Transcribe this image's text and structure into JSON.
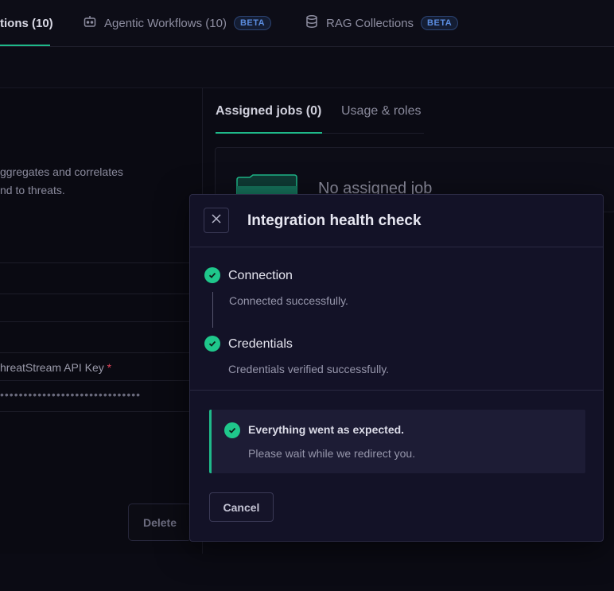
{
  "top_tabs": [
    {
      "label": "tions (10)",
      "active": true
    },
    {
      "label": "Agentic Workflows (10)",
      "badge": "BETA",
      "icon": "robot-icon"
    },
    {
      "label": "RAG Collections",
      "badge": "BETA",
      "icon": "database-icon"
    }
  ],
  "left_panel": {
    "description_line1": "ggregates and correlates",
    "description_line2": "nd to threats.",
    "api_key_label": "hreatStream API Key",
    "required_mark": "*",
    "api_key_value": "••••••••••••••••••••••••••••••",
    "delete_label": "Delete"
  },
  "right_panel": {
    "tabs": [
      {
        "label": "Assigned jobs (0)",
        "active": true
      },
      {
        "label": "Usage & roles",
        "active": false
      }
    ],
    "empty_text": "No assigned job",
    "empty_icon": "folder-icon"
  },
  "dialog": {
    "title": "Integration health check",
    "close_icon": "close-icon",
    "steps": [
      {
        "title": "Connection",
        "description": "Connected successfully.",
        "status": "success"
      },
      {
        "title": "Credentials",
        "description": "Credentials verified successfully.",
        "status": "success"
      }
    ],
    "notice": {
      "title": "Everything went as expected.",
      "description": "Please wait while we redirect you."
    },
    "cancel_label": "Cancel"
  },
  "colors": {
    "accent": "#1fb98a",
    "success": "#1fc78b",
    "beta": "#5b8de0",
    "required": "#e0445a",
    "dialog_bg": "#131227"
  }
}
